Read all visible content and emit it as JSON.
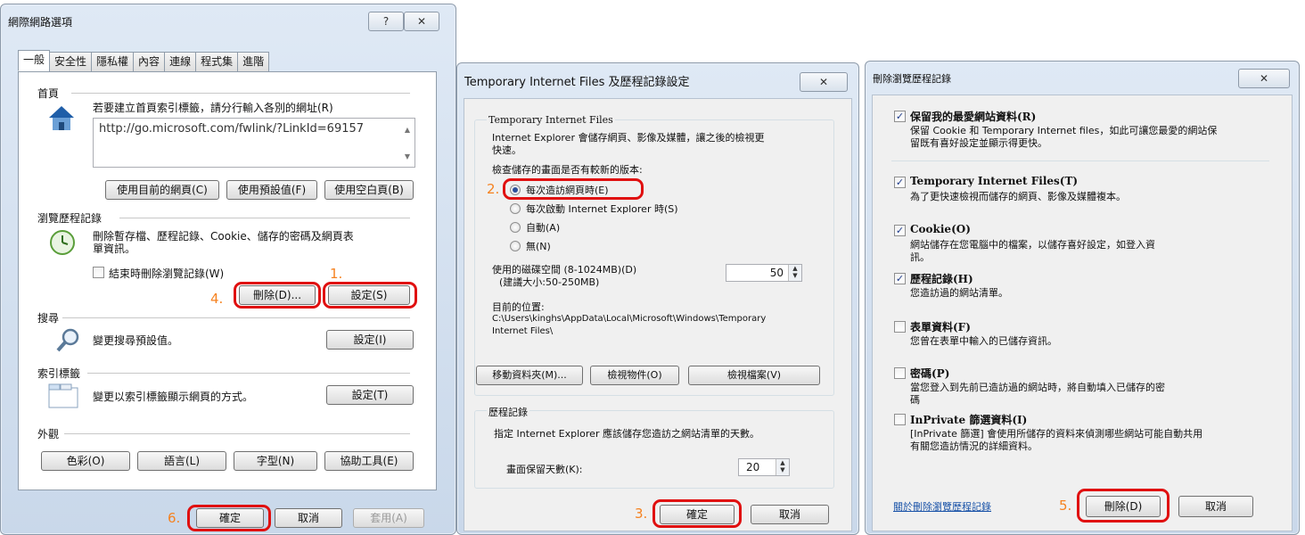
{
  "internet_options": {
    "title": "網際網路選項",
    "help_button": "?",
    "close_button": "✕",
    "tabs": [
      "一般",
      "安全性",
      "隱私權",
      "內容",
      "連線",
      "程式集",
      "進階"
    ],
    "home_page": {
      "heading": "首頁",
      "instruction": "若要建立首頁索引標籤，請分行輸入各別的網址(R)",
      "url": "http://go.microsoft.com/fwlink/?LinkId=69157",
      "use_current": "使用目前的網頁(C)",
      "use_default": "使用預設值(F)",
      "use_blank": "使用空白頁(B)"
    },
    "history": {
      "heading": "瀏覽歷程記錄",
      "desc_line1": "刪除暫存檔、歷程記錄、Cookie、儲存的密碼及網頁表",
      "desc_line2": "單資訊。",
      "on_exit_checkbox": "結束時刪除瀏覽記錄(W)",
      "delete_button": "刪除(D)...",
      "settings_button": "設定(S)"
    },
    "search": {
      "heading": "搜尋",
      "desc": "變更搜尋預設值。",
      "settings_button": "設定(I)"
    },
    "tabs_section": {
      "heading": "索引標籤",
      "desc": "變更以索引標籤顯示網頁的方式。",
      "settings_button": "設定(T)"
    },
    "appearance": {
      "heading": "外觀",
      "colors": "色彩(O)",
      "languages": "語言(L)",
      "fonts": "字型(N)",
      "accessibility": "協助工具(E)"
    },
    "ok_button": "確定",
    "cancel_button": "取消",
    "apply_button": "套用(A)"
  },
  "tif_settings": {
    "title": "Temporary Internet Files 及歷程記錄設定",
    "close_button": "✕",
    "group_title": "Temporary Internet Files",
    "desc_line1": "Internet Explorer 會儲存網頁、影像及媒體，讓之後的檢視更",
    "desc_line2": "快速。",
    "check_prompt": "檢查儲存的畫面是否有較新的版本:",
    "options": [
      "每次造訪網頁時(E)",
      "每次啟動 Internet Explorer 時(S)",
      "自動(A)",
      "無(N)"
    ],
    "selected_option": 0,
    "disk_label_line1": "使用的磁碟空間 (8-1024MB)(D)",
    "disk_label_line2": "(建議大小:50-250MB)",
    "disk_value": "50",
    "location_label": "目前的位置:",
    "location_line1": "C:\\Users\\kinghs\\AppData\\Local\\Microsoft\\Windows\\Temporary",
    "location_line2": "Internet Files\\",
    "move_folder": "移動資料夾(M)...",
    "view_objects": "檢視物件(O)",
    "view_files": "檢視檔案(V)",
    "history_title": "歷程記錄",
    "history_desc": "指定 Internet Explorer 應該儲存您造訪之網站清單的天數。",
    "days_label": "畫面保留天數(K):",
    "days_value": "20",
    "ok_button": "確定",
    "cancel_button": "取消"
  },
  "delete_history": {
    "title": "刪除瀏覽歷程記錄",
    "close_button": "✕",
    "items": [
      {
        "label": "保留我的最愛網站資料(R)",
        "desc_line1": "保留 Cookie 和 Temporary Internet files，如此可讓您最愛的網站保",
        "desc_line2": "留既有喜好設定並顯示得更快。",
        "checked": true
      },
      {
        "label": "Temporary Internet Files(T)",
        "desc_line1": "為了更快速檢視而儲存的網頁、影像及媒體複本。",
        "desc_line2": "",
        "checked": true
      },
      {
        "label": "Cookie(O)",
        "desc_line1": "網站儲存在您電腦中的檔案，以儲存喜好設定，如登入資",
        "desc_line2": "訊。",
        "checked": true
      },
      {
        "label": "歷程記錄(H)",
        "desc_line1": "您造訪過的網站清單。",
        "desc_line2": "",
        "checked": true
      },
      {
        "label": "表單資料(F)",
        "desc_line1": "您曾在表單中輸入的已儲存資訊。",
        "desc_line2": "",
        "checked": false
      },
      {
        "label": "密碼(P)",
        "desc_line1": "當您登入到先前已造訪過的網站時，將自動填入已儲存的密",
        "desc_line2": "碼",
        "checked": false
      },
      {
        "label": "InPrivate 篩選資料(I)",
        "desc_line1": "[InPrivate 篩選] 會使用所儲存的資料來偵測哪些網站可能自動共用",
        "desc_line2": "有關您造訪情況的詳細資料。",
        "checked": false
      }
    ],
    "about_link": "關於刪除瀏覽歷程記錄",
    "delete_button": "刪除(D)",
    "cancel_button": "取消"
  },
  "annotations": {
    "step1": "1.",
    "step2": "2.",
    "step3": "3.",
    "step4": "4.",
    "step5": "5.",
    "step6": "6.",
    "highlight_color": "#e01010",
    "step_color": "#f58220"
  }
}
